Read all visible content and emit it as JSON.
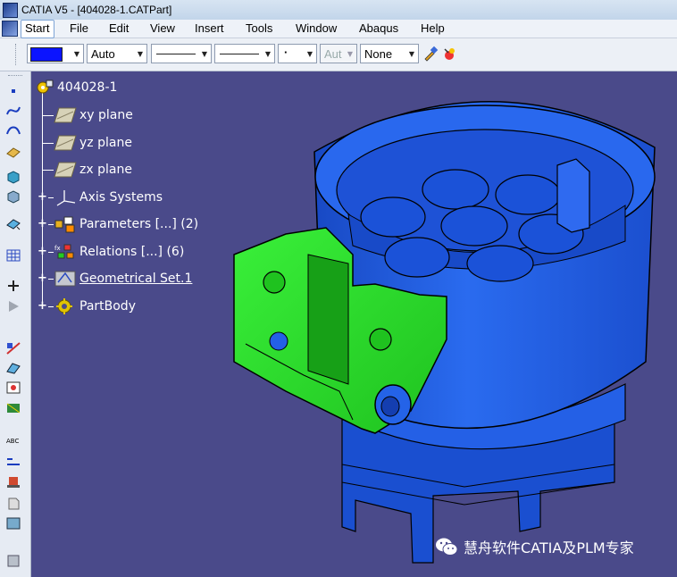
{
  "window": {
    "title": "CATIA V5 - [404028-1.CATPart]"
  },
  "menubar": {
    "items": [
      "Start",
      "File",
      "Edit",
      "View",
      "Insert",
      "Tools",
      "Window",
      "Abaqus",
      "Help"
    ]
  },
  "toolbar": {
    "fill_color": "#0b14ff",
    "transparency": "Auto",
    "point_type": "·",
    "layer_placeholder": "Aut",
    "layer": "None"
  },
  "tree": {
    "root": "404028-1",
    "nodes": [
      {
        "label": "xy plane",
        "icon": "plane-icon"
      },
      {
        "label": "yz plane",
        "icon": "plane-icon"
      },
      {
        "label": "zx plane",
        "icon": "plane-icon"
      },
      {
        "label": "Axis Systems",
        "icon": "axis-system-icon"
      },
      {
        "label": "Parameters [...] (2)",
        "icon": "parameters-icon"
      },
      {
        "label": "Relations [...] (6)",
        "icon": "relations-icon"
      },
      {
        "label": "Geometrical Set.1",
        "icon": "geometrical-set-icon"
      },
      {
        "label": "PartBody",
        "icon": "partbody-icon"
      }
    ]
  },
  "watermark": {
    "text": "慧舟软件CATIA及PLM专家"
  },
  "colors": {
    "background": "#4a4a8a",
    "part_blue": "#1f5fe0",
    "part_green": "#2ee02e"
  }
}
